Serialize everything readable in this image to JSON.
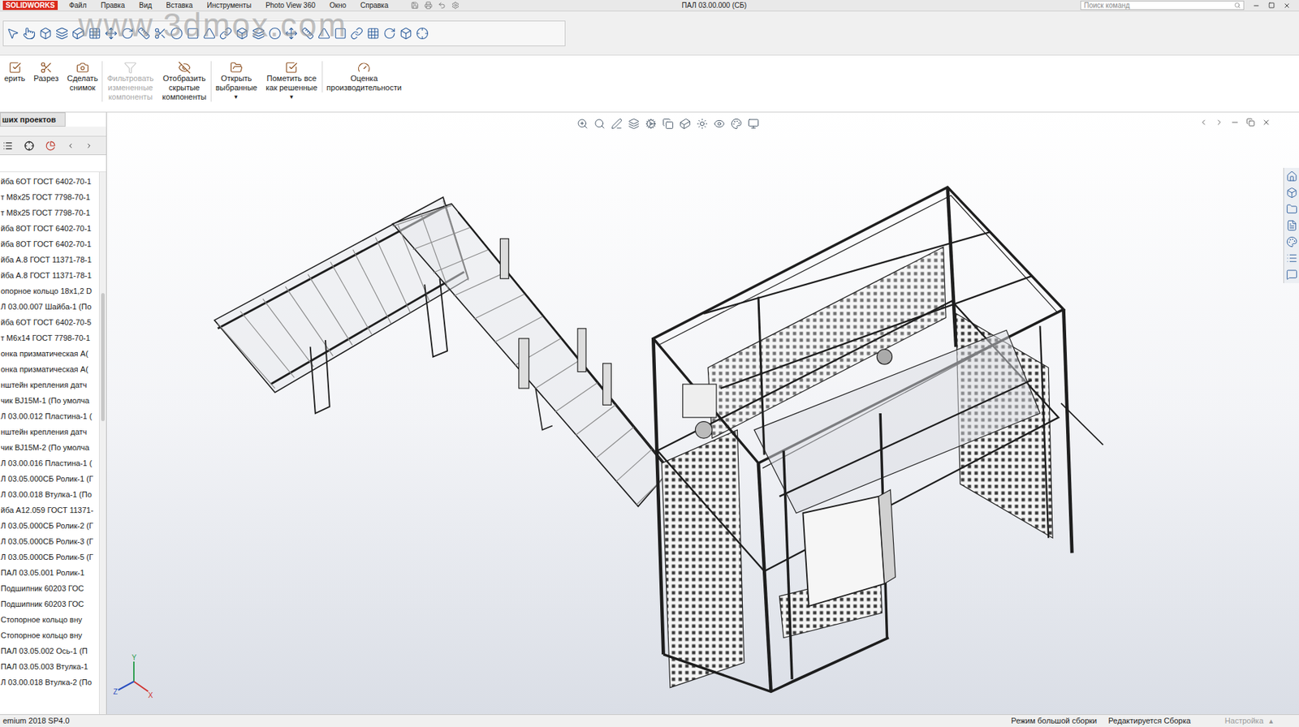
{
  "window": {
    "logo": "SOLIDWORKS",
    "menus": [
      "Файл",
      "Правка",
      "Вид",
      "Вставка",
      "Инструменты",
      "Photo View 360",
      "Окно",
      "Справка"
    ],
    "title": "ПАЛ 03.00.000 (СБ)",
    "search": {
      "placeholder": "Поиск команд"
    }
  },
  "watermark": "www.3dmox.com",
  "command_manager": {
    "buttons": [
      {
        "lines": [
          "ерить"
        ],
        "disabled": false,
        "arrow": ""
      },
      {
        "lines": [
          "Разрез"
        ],
        "disabled": false,
        "arrow": ""
      },
      {
        "lines": [
          "Сделать",
          "снимок"
        ],
        "disabled": false,
        "arrow": ""
      },
      {
        "lines": [
          "Фильтровать",
          "измененные",
          "компоненты"
        ],
        "disabled": true,
        "arrow": ""
      },
      {
        "lines": [
          "Отобразить",
          "скрытые",
          "компоненты"
        ],
        "disabled": false,
        "arrow": ""
      },
      {
        "lines": [
          "Открыть",
          "выбранные"
        ],
        "disabled": false,
        "arrow": "▾"
      },
      {
        "lines": [
          "Пометить все",
          "как решенные"
        ],
        "disabled": false,
        "arrow": "▾"
      },
      {
        "lines": [
          "Оценка",
          "производительности"
        ],
        "disabled": false,
        "arrow": ""
      }
    ]
  },
  "panel": {
    "tab": "ших проектов",
    "tree": [
      "йба 6ОТ ГОСТ 6402-70-1",
      "т М8х25 ГОСТ 7798-70-1",
      "т М8х25 ГОСТ 7798-70-1",
      "йба 8ОТ ГОСТ 6402-70-1",
      "йба 8ОТ ГОСТ 6402-70-1",
      "йба А.8 ГОСТ 11371-78-1",
      "йба А.8 ГОСТ 11371-78-1",
      "опорное кольцо 18х1,2 D",
      "Л 03.00.007 Шайба-1 (По",
      "йба 6ОТ ГОСТ 6402-70-5",
      "т М6х14 ГОСТ 7798-70-1",
      "онка призматическая А(",
      "онка призматическая А(",
      "нштейн крепления датч",
      "чик BJ15M-1 (По умолча",
      "Л 03.00.012 Пластина-1 (",
      "нштейн крепления датч",
      "чик BJ15M-2 (По умолча",
      "Л 03.00.016 Пластина-1 (",
      "Л 03.05.000СБ Ролик-1 (Г",
      "Л 03.00.018 Втулка-1 (По",
      "йба А12.059 ГОСТ 11371-",
      "Л 03.05.000СБ Ролик-2 (Г",
      "Л 03.05.000СБ Ролик-3 (Г",
      "Л 03.05.000СБ Ролик-5 (Г",
      "ПАЛ 03.05.001 Ролик-1",
      "Подшипник 60203 ГОС",
      "Подшипник 60203 ГОС",
      "Стопорное кольцо вну",
      "Стопорное кольцо вну",
      "ПАЛ 03.05.002 Ось-1 (П",
      "ПАЛ 03.05.003 Втулка-1",
      "Л 03.00.018 Втулка-2 (По"
    ]
  },
  "viewport": {
    "triad": {
      "x": "X",
      "y": "Y",
      "z": "Z"
    }
  },
  "status_bar": {
    "version": "emium 2018 SP4.0",
    "items": [
      "Режим большой сборки",
      "Редактируется Сборка"
    ],
    "settings": {
      "label": "Настройка",
      "disabled": true,
      "arrow": "▴"
    }
  }
}
